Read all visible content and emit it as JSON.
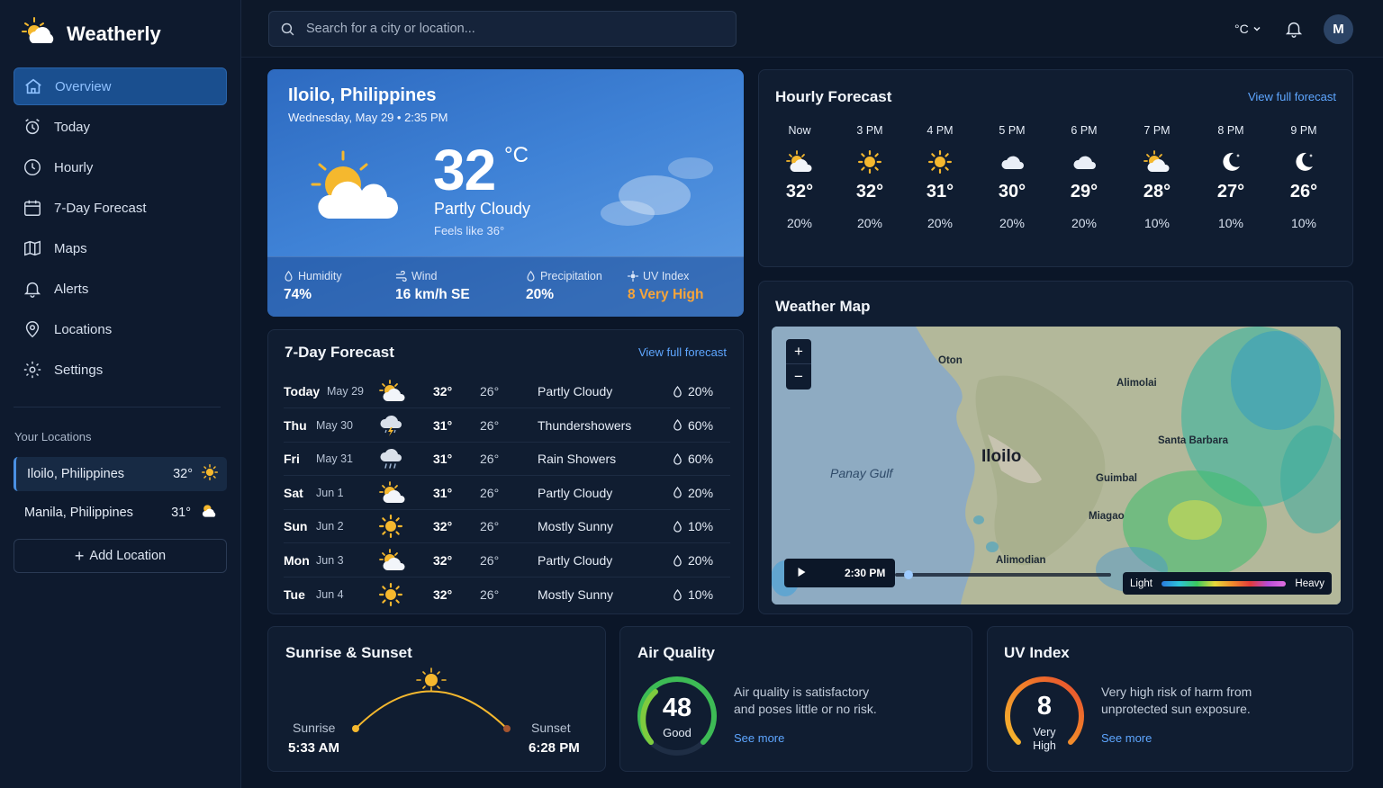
{
  "app": {
    "name": "Weatherly"
  },
  "nav": [
    {
      "label": "Overview",
      "icon": "home-icon"
    },
    {
      "label": "Today",
      "icon": "alarm-clock-icon"
    },
    {
      "label": "Hourly",
      "icon": "clock-icon"
    },
    {
      "label": "7-Day Forecast",
      "icon": "calendar-icon"
    },
    {
      "label": "Maps",
      "icon": "map-icon"
    },
    {
      "label": "Alerts",
      "icon": "bell-icon"
    },
    {
      "label": "Locations",
      "icon": "location-pin-icon"
    },
    {
      "label": "Settings",
      "icon": "gear-icon"
    }
  ],
  "your_locations": {
    "heading": "Your Locations",
    "items": [
      {
        "name": "Iloilo, Philippines",
        "temp": "32°",
        "icon": "sun-icon"
      },
      {
        "name": "Manila, Philippines",
        "temp": "31°",
        "icon": "partly-cloudy-icon"
      }
    ],
    "add_label": "Add Location"
  },
  "topbar": {
    "search_placeholder": "Search for a city or location...",
    "unit": "°C",
    "avatar": "M"
  },
  "current": {
    "city": "Iloilo, Philippines",
    "datetime": "Wednesday, May 29 • 2:35 PM",
    "temp": "32",
    "unit": "°C",
    "condition": "Partly Cloudy",
    "feels_like": "Feels like 36°",
    "stats": [
      {
        "label": "Humidity",
        "value": "74%",
        "icon": "droplet-icon"
      },
      {
        "label": "Wind",
        "value": "16 km/h SE",
        "icon": "wind-icon"
      },
      {
        "label": "Precipitation",
        "value": "20%",
        "icon": "rain-drop-icon"
      },
      {
        "label": "UV Index",
        "value": "8 Very High",
        "icon": "sun-small-icon"
      }
    ]
  },
  "hourly": {
    "title": "Hourly Forecast",
    "link": "View full forecast",
    "items": [
      {
        "time": "Now",
        "icon": "partly-cloudy-icon",
        "temp": "32°",
        "precip": "20%"
      },
      {
        "time": "3 PM",
        "icon": "sun-icon",
        "temp": "32°",
        "precip": "20%"
      },
      {
        "time": "4 PM",
        "icon": "sun-icon",
        "temp": "31°",
        "precip": "20%"
      },
      {
        "time": "5 PM",
        "icon": "cloud-icon",
        "temp": "30°",
        "precip": "20%"
      },
      {
        "time": "6 PM",
        "icon": "cloud-icon",
        "temp": "29°",
        "precip": "20%"
      },
      {
        "time": "7 PM",
        "icon": "partly-cloudy-icon",
        "temp": "28°",
        "precip": "10%"
      },
      {
        "time": "8 PM",
        "icon": "moon-icon",
        "temp": "27°",
        "precip": "10%"
      },
      {
        "time": "9 PM",
        "icon": "moon-icon",
        "temp": "26°",
        "precip": "10%"
      }
    ]
  },
  "forecast": {
    "title": "7-Day Forecast",
    "link": "View full forecast",
    "days": [
      {
        "day": "Today",
        "date": "May 29",
        "icon": "partly-cloudy-icon",
        "hi": "32°",
        "lo": "26°",
        "cond": "Partly Cloudy",
        "precip": "20%"
      },
      {
        "day": "Thu",
        "date": "May 30",
        "icon": "thunderstorm-icon",
        "hi": "31°",
        "lo": "26°",
        "cond": "Thundershowers",
        "precip": "60%"
      },
      {
        "day": "Fri",
        "date": "May 31",
        "icon": "rain-icon",
        "hi": "31°",
        "lo": "26°",
        "cond": "Rain Showers",
        "precip": "60%"
      },
      {
        "day": "Sat",
        "date": "Jun 1",
        "icon": "partly-cloudy-icon",
        "hi": "31°",
        "lo": "26°",
        "cond": "Partly Cloudy",
        "precip": "20%"
      },
      {
        "day": "Sun",
        "date": "Jun 2",
        "icon": "sun-icon",
        "hi": "32°",
        "lo": "26°",
        "cond": "Mostly Sunny",
        "precip": "10%"
      },
      {
        "day": "Mon",
        "date": "Jun 3",
        "icon": "partly-cloudy-icon",
        "hi": "32°",
        "lo": "26°",
        "cond": "Partly Cloudy",
        "precip": "20%"
      },
      {
        "day": "Tue",
        "date": "Jun 4",
        "icon": "sun-icon",
        "hi": "32°",
        "lo": "26°",
        "cond": "Mostly Sunny",
        "precip": "10%"
      }
    ]
  },
  "map": {
    "title": "Weather Map",
    "zoom_in": "+",
    "zoom_out": "−",
    "time": "2:30 PM",
    "legend_light": "Light",
    "legend_heavy": "Heavy",
    "places": [
      "Oton",
      "Alimodian",
      "Iloilo",
      "Panay Gulf",
      "Santa Barbara",
      "Guimbal",
      "Miagao",
      "Alimolai"
    ]
  },
  "sun": {
    "title": "Sunrise & Sunset",
    "sunrise_label": "Sunrise",
    "sunrise": "5:33 AM",
    "sunset_label": "Sunset",
    "sunset": "6:28 PM"
  },
  "air_quality": {
    "title": "Air Quality",
    "value": "48",
    "level": "Good",
    "desc_line1": "Air quality is satisfactory",
    "desc_line2": "and poses little or no risk.",
    "link": "See more"
  },
  "uv": {
    "title": "UV Index",
    "value": "8",
    "level_line1": "Very",
    "level_line2": "High",
    "desc_line1": "Very high risk of harm from",
    "desc_line2": "unprotected sun exposure.",
    "link": "See more"
  },
  "colors": {
    "accent": "#5ea6ff",
    "warning": "#f6a43a",
    "background": "#0b1628"
  }
}
